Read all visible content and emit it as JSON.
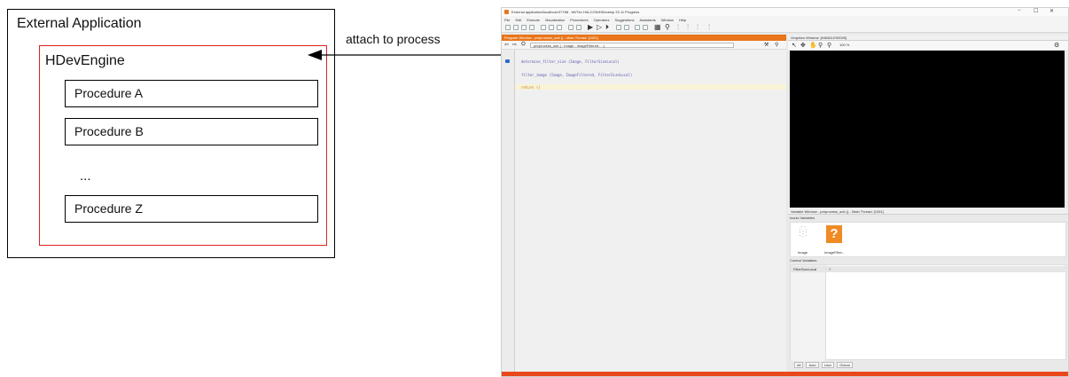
{
  "diagram": {
    "external_label": "External Application",
    "engine_label": "HDevEngine",
    "procedures": [
      "Procedure A",
      "Procedure B",
      "Procedure Z"
    ],
    "ellipsis": "...",
    "arrow_label": "attach to process",
    "colors": {
      "engine_border": "#dd2222",
      "box_border": "#000000"
    }
  },
  "app": {
    "title": "External application/localhost:37788 - MVTec HALCON/HDevelop 20.11 Progress",
    "window_controls": [
      "−",
      "☐",
      "✕"
    ],
    "menu": [
      "File",
      "Edit",
      "Execute",
      "Visualization",
      "Procedures",
      "Operators",
      "Suggestions",
      "Assistants",
      "Window",
      "Help"
    ],
    "program_window": {
      "title": "Program Window - preprocess_sub () - Main Thread: [1051]",
      "procedure_select": "preprocess_sub ( : Image : ImageFiltered : : )",
      "code_lines": [
        "determine_filter_size (Image, FilterSizeLocal)",
        "filter_image (Image, ImageFiltered, FilterSizeLocal)",
        "return ()"
      ],
      "accent_color": "#e8751a"
    },
    "graphics_window": {
      "title": "Graphics Window: [HANDLE00000]",
      "zoom": "100 %"
    },
    "variable_window": {
      "title": "Variable Window - preprocess_sub () - Main Thread: [1051]",
      "iconic_label": "Iconic Variables",
      "iconic_vars": [
        "Image",
        "ImageFilter..."
      ],
      "control_label": "Control Variables",
      "control_vars": [
        {
          "name": "FilterSizeLocal",
          "value": "?"
        }
      ],
      "tabs": [
        "All",
        "Auto",
        "User",
        "Global"
      ]
    },
    "status_color": "#e8481c"
  }
}
